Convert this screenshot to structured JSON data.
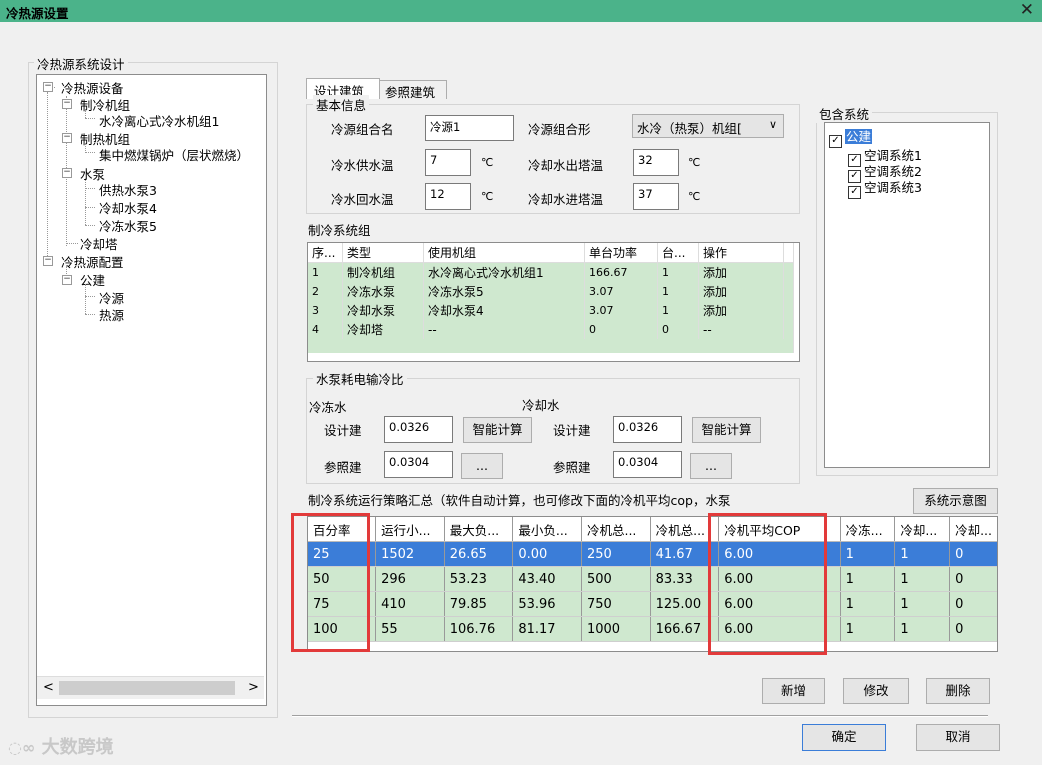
{
  "window": {
    "title": "冷热源设置",
    "close": "✕"
  },
  "left_group": {
    "label": "冷热源系统设计",
    "tree": [
      {
        "text": "冷热源设备"
      },
      {
        "text": "制冷机组"
      },
      {
        "text": "水冷离心式冷水机组1"
      },
      {
        "text": "制热机组"
      },
      {
        "text": "集中燃煤锅炉（层状燃烧）"
      },
      {
        "text": "水泵"
      },
      {
        "text": "供热水泵3"
      },
      {
        "text": "冷却水泵4"
      },
      {
        "text": "冷冻水泵5"
      },
      {
        "text": "冷却塔"
      },
      {
        "text": "冷热源配置"
      },
      {
        "text": "公建"
      },
      {
        "text": "冷源"
      },
      {
        "text": "热源"
      }
    ],
    "scroll_left": "<",
    "scroll_right": ">"
  },
  "tabs": [
    {
      "label": "设计建筑"
    },
    {
      "label": "参照建筑"
    }
  ],
  "basic_info": {
    "label": "基本信息",
    "combo_name_label": "冷源组合名",
    "combo_name_value": "冷源1",
    "combo_type_label": "冷源组合形",
    "combo_type_value": "水冷（热泵）机组[",
    "supply_label": "冷水供水温",
    "supply_value": "7",
    "return_label": "冷水回水温",
    "return_value": "12",
    "tower_out_label": "冷却水出塔温",
    "tower_out_value": "32",
    "tower_in_label": "冷却水进塔温",
    "tower_in_value": "37",
    "unit": "℃"
  },
  "include_system": {
    "label": "包含系统",
    "root": "公建",
    "items": [
      "空调系统1",
      "空调系统2",
      "空调系统3"
    ],
    "check": "✓"
  },
  "cooling_group": {
    "label": "制冷系统组",
    "headers": [
      "序...",
      "类型",
      "使用机组",
      "单台功率",
      "台...",
      "操作"
    ],
    "rows": [
      [
        "1",
        "制冷机组",
        "水冷离心式冷水机组1",
        "166.67",
        "1",
        "添加"
      ],
      [
        "2",
        "冷冻水泵",
        "冷冻水泵5",
        "3.07",
        "1",
        "添加"
      ],
      [
        "3",
        "冷却水泵",
        "冷却水泵4",
        "3.07",
        "1",
        "添加"
      ],
      [
        "4",
        "冷却塔",
        "--",
        "0",
        "0",
        "--"
      ]
    ]
  },
  "pump_ratio": {
    "label": "水泵耗电输冷比",
    "chilled_label": "冷冻水",
    "cooling_label": "冷却水",
    "design_label": "设计建",
    "ref_label": "参照建",
    "chilled_design": "0.0326",
    "chilled_ref": "0.0304",
    "cooling_design": "0.0326",
    "cooling_ref": "0.0304",
    "smart_calc": "智能计算",
    "ellipsis": "..."
  },
  "strategy": {
    "label": "制冷系统运行策略汇总（软件自动计算，也可修改下面的冷机平均cop，水泵",
    "diagram_button": "系统示意图",
    "headers": [
      "百分率",
      "运行小...",
      "最大负...",
      "最小负...",
      "冷机总...",
      "冷机总...",
      "冷机平均COP",
      "冷冻...",
      "冷却...",
      "冷却..."
    ],
    "rows": [
      [
        "25",
        "1502",
        "26.65",
        "0.00",
        "250",
        "41.67",
        "6.00",
        "1",
        "1",
        "0"
      ],
      [
        "50",
        "296",
        "53.23",
        "43.40",
        "500",
        "83.33",
        "6.00",
        "1",
        "1",
        "0"
      ],
      [
        "75",
        "410",
        "79.85",
        "53.96",
        "750",
        "125.00",
        "6.00",
        "1",
        "1",
        "0"
      ],
      [
        "100",
        "55",
        "106.76",
        "81.17",
        "1000",
        "166.67",
        "6.00",
        "1",
        "1",
        "0"
      ]
    ],
    "highlight_color": "#e23a3a"
  },
  "buttons": {
    "add": "新增",
    "modify": "修改",
    "delete": "删除",
    "ok": "确定",
    "cancel": "取消"
  },
  "watermark": "大数跨境"
}
